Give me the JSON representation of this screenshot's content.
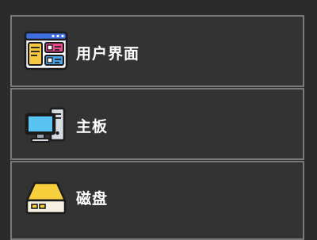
{
  "menu": {
    "items": [
      {
        "label": "用户界面",
        "icon": "ui-window-icon"
      },
      {
        "label": "主板",
        "icon": "desktop-computer-icon"
      },
      {
        "label": "磁盘",
        "icon": "disk-drive-icon"
      }
    ]
  },
  "colors": {
    "background": "#2b2b2b",
    "item_background": "#333333",
    "item_border": "#7a7a7a",
    "text": "#ffffff"
  }
}
